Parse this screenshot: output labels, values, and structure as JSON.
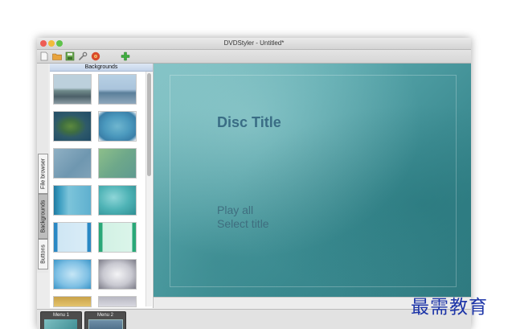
{
  "window": {
    "title": "DVDStyler - Untitled*",
    "controls": [
      "close",
      "minimize",
      "maximize"
    ]
  },
  "toolbar": {
    "buttons": [
      {
        "name": "new-icon",
        "color": "#f0f0f0"
      },
      {
        "name": "open-folder-icon",
        "color": "#e8a33c"
      },
      {
        "name": "save-icon",
        "color": "#6aa84f"
      },
      {
        "name": "settings-icon",
        "color": "#8a8a8a"
      },
      {
        "name": "burn-disc-icon",
        "color": "#d94a2b"
      },
      {
        "name": "add-icon",
        "color": "#3fae3f"
      }
    ]
  },
  "side_tabs": [
    {
      "label": "File browser",
      "active": false
    },
    {
      "label": "Backgrounds",
      "active": true
    },
    {
      "label": "Buttons",
      "active": false
    }
  ],
  "panel": {
    "header": "Backgrounds",
    "thumbnail_count": 12
  },
  "menu": {
    "title": "Disc Title",
    "buttons": [
      "Play all",
      "Select title"
    ]
  },
  "menus_tray": {
    "items": [
      {
        "label": "Menu 1",
        "selected": true
      },
      {
        "label": "Menu 2",
        "selected": false
      }
    ]
  },
  "watermark": "最需教育",
  "colors": {
    "menu_text": "#3a6d85",
    "panel_header": "#c4d4ea",
    "watermark": "#1d35a8"
  }
}
